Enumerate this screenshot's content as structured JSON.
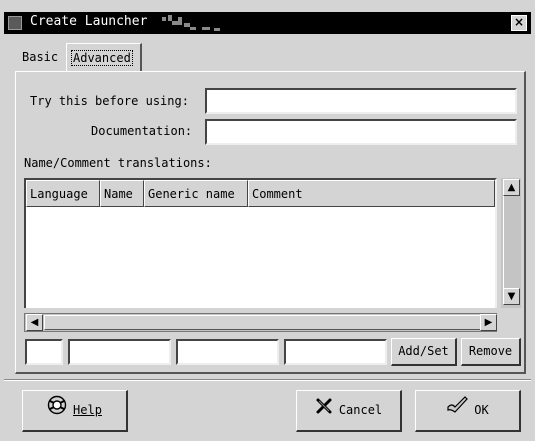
{
  "window": {
    "title": "Create Launcher"
  },
  "tabs": [
    {
      "label": "Basic"
    },
    {
      "label": "Advanced"
    }
  ],
  "form": {
    "try_label": "Try this before using:",
    "try_value": "",
    "doc_label": "Documentation:",
    "doc_value": ""
  },
  "translations": {
    "label": "Name/Comment translations:",
    "columns": [
      "Language",
      "Name",
      "Generic name",
      "Comment"
    ],
    "rows": []
  },
  "edit_row": {
    "add_set": "Add/Set",
    "remove": "Remove"
  },
  "footer": {
    "help": "Help",
    "cancel": "Cancel",
    "ok": "OK"
  }
}
